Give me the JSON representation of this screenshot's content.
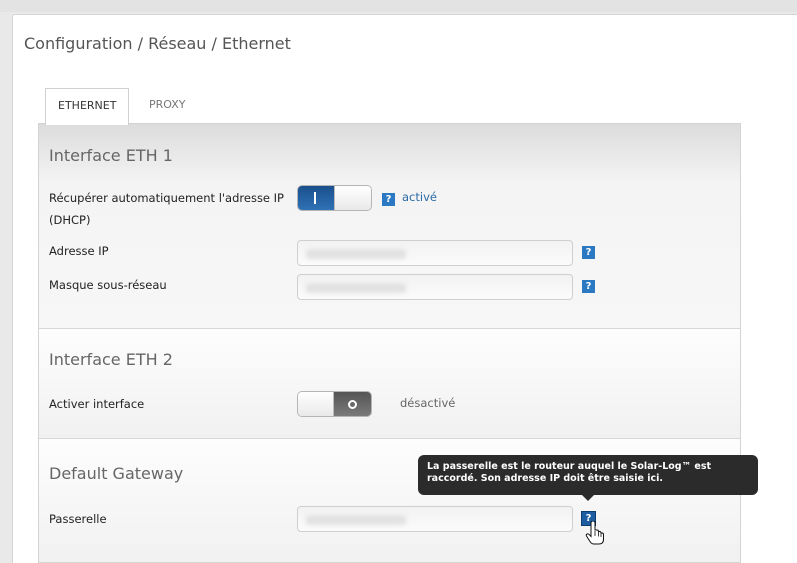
{
  "breadcrumb": "Configuration / Réseau / Ethernet",
  "tabs": [
    {
      "label": "ETHERNET",
      "active": true
    },
    {
      "label": "PROXY",
      "active": false
    }
  ],
  "eth1": {
    "title": "Interface ETH 1",
    "dhcp_label": "Récupérer automatiquement l'adresse IP (DHCP)",
    "dhcp_status": "activé",
    "dhcp_on": true,
    "ip_label": "Adresse IP",
    "ip_value": "",
    "mask_label": "Masque sous-réseau",
    "mask_value": ""
  },
  "eth2": {
    "title": "Interface ETH 2",
    "enable_label": "Activer interface",
    "enable_status": "désactivé",
    "enable_on": false
  },
  "gateway": {
    "title": "Default Gateway",
    "label": "Passerelle",
    "value": "",
    "tooltip": "La passerelle est le routeur auquel le Solar-Log™ est raccordé. Son adresse IP doit être saisie ici."
  },
  "help_glyph": "?",
  "colors": {
    "accent": "#2b79c2",
    "toggle_on": "#1a4f8c",
    "toggle_off": "#6a6a6a",
    "status_text": "#2b6aa6",
    "tooltip_bg": "#2b2b2b"
  },
  "icons": [
    "help-icon",
    "hand-cursor-icon"
  ]
}
